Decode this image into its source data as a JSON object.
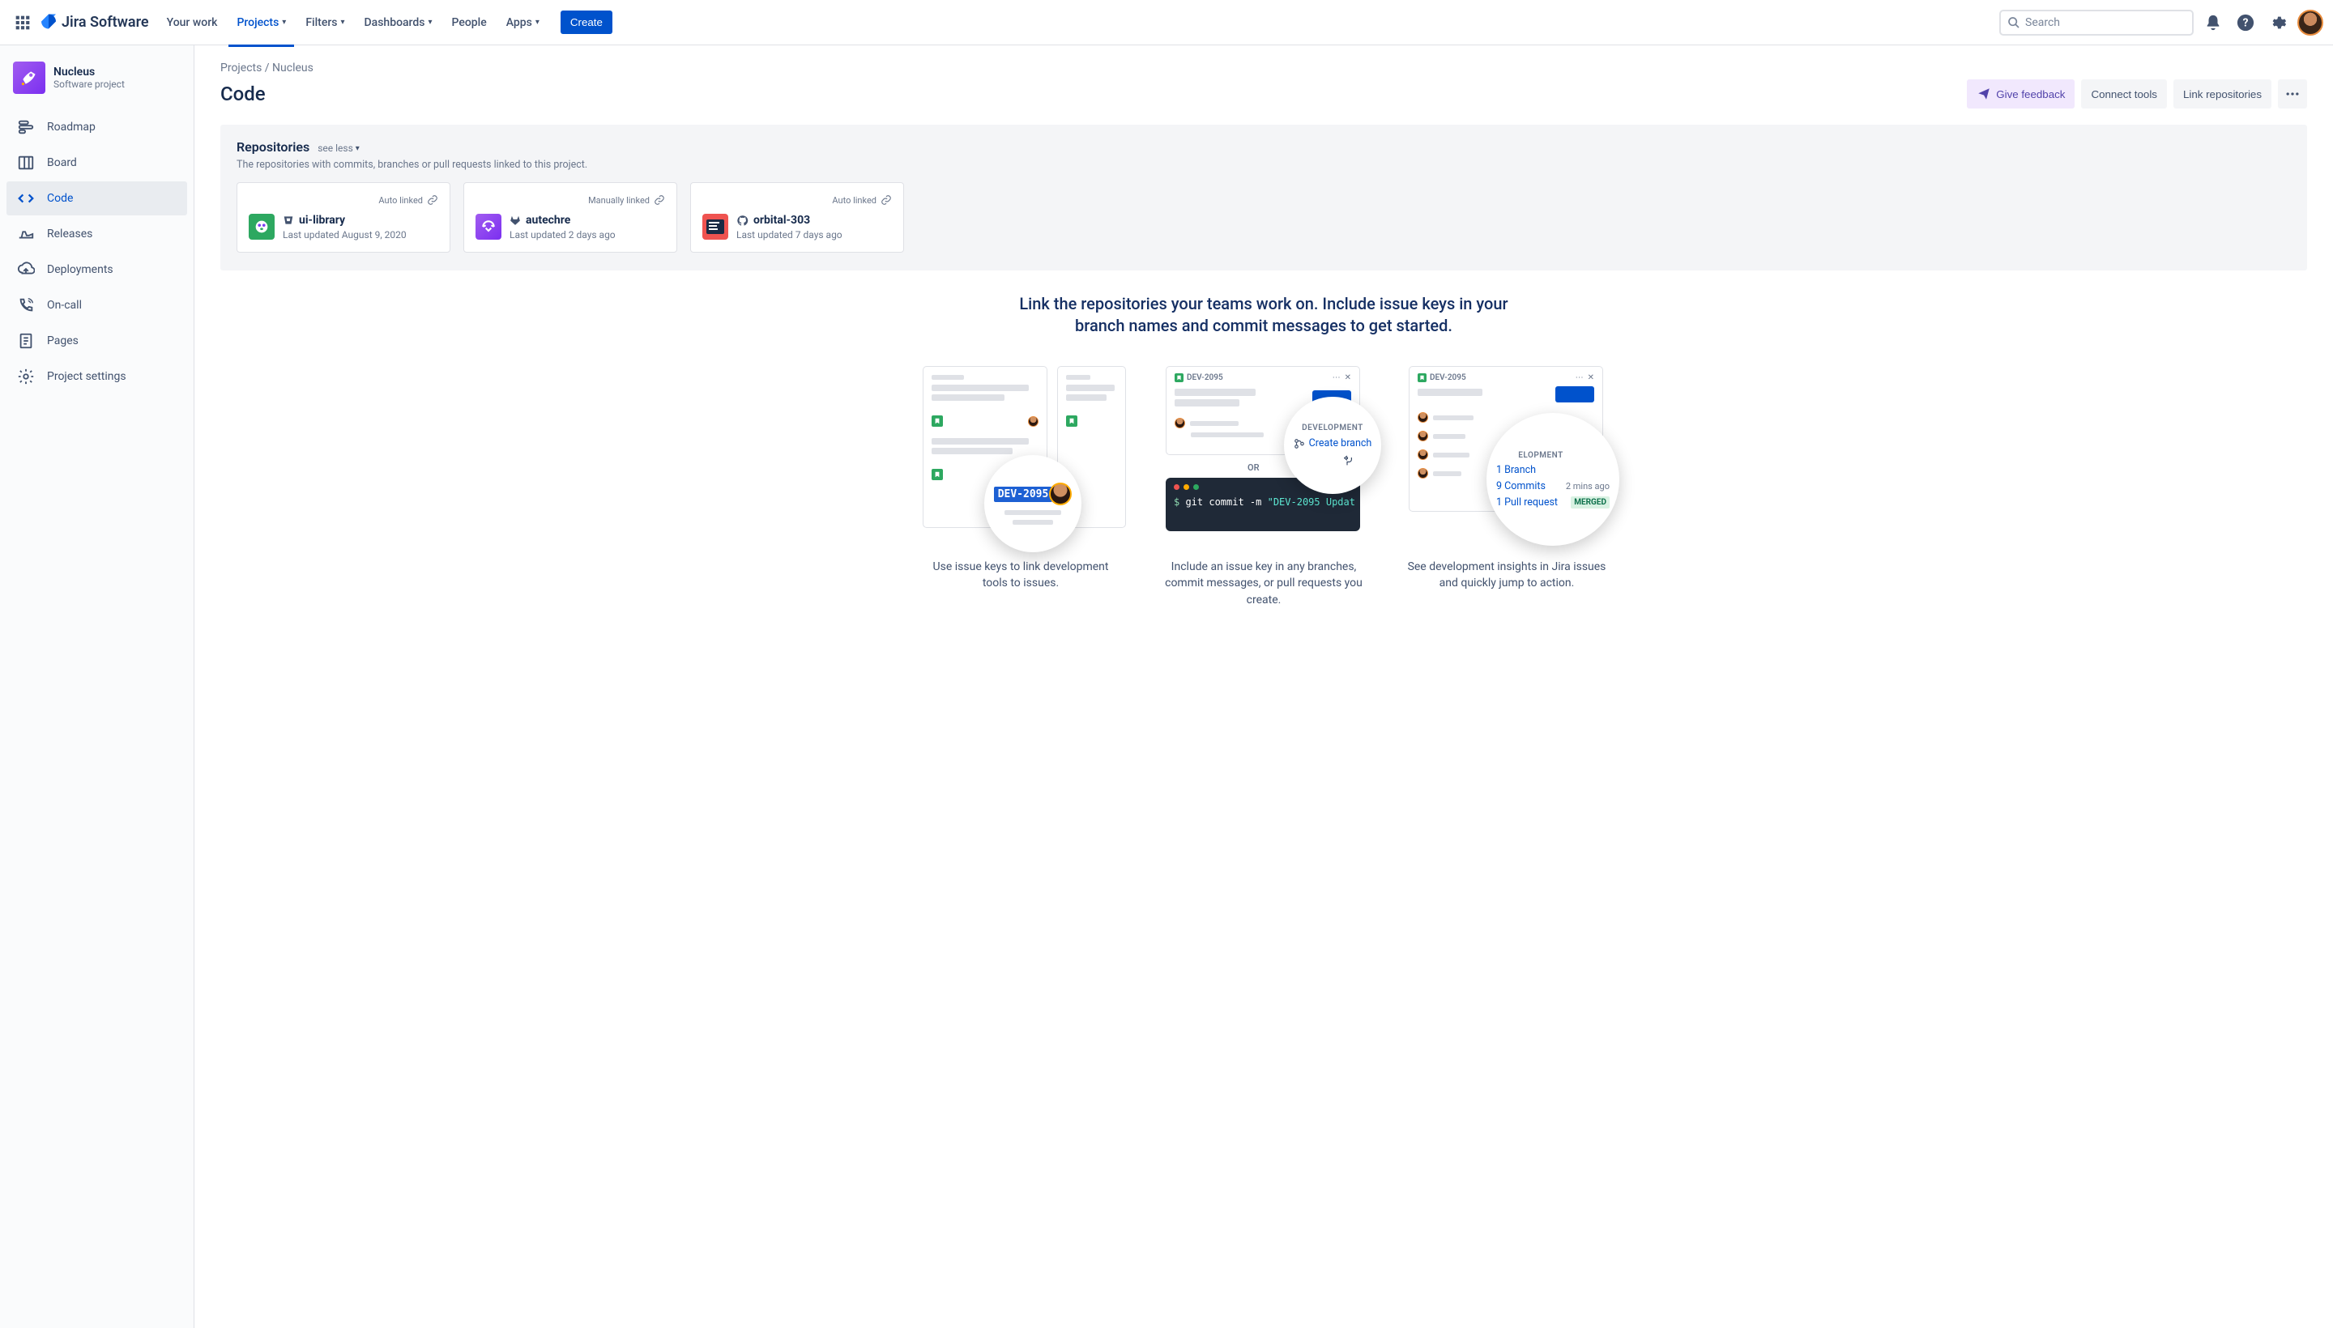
{
  "nav": {
    "logo": "Jira Software",
    "items": [
      "Your work",
      "Projects",
      "Filters",
      "Dashboards",
      "People",
      "Apps"
    ],
    "create": "Create",
    "search_placeholder": "Search"
  },
  "project": {
    "name": "Nucleus",
    "subtitle": "Software project"
  },
  "sidebar": {
    "items": [
      {
        "label": "Roadmap"
      },
      {
        "label": "Board"
      },
      {
        "label": "Code"
      },
      {
        "label": "Releases"
      },
      {
        "label": "Deployments"
      },
      {
        "label": "On-call"
      },
      {
        "label": "Pages"
      },
      {
        "label": "Project settings"
      }
    ]
  },
  "breadcrumb": "Projects / Nucleus",
  "page_title": "Code",
  "actions": {
    "feedback": "Give feedback",
    "connect": "Connect tools",
    "link": "Link repositories"
  },
  "repos": {
    "title": "Repositories",
    "toggle": "see less",
    "desc": "The repositories with commits, branches or pull requests linked to this project.",
    "cards": [
      {
        "link_type": "Auto linked",
        "name": "ui-library",
        "updated": "Last updated August 9, 2020",
        "icon_color": "#2da860"
      },
      {
        "link_type": "Manually linked",
        "name": "autechre",
        "updated": "Last updated 2 days ago",
        "icon_color": "#8b5cf6"
      },
      {
        "link_type": "Auto linked",
        "name": "orbital-303",
        "updated": "Last updated 7 days ago",
        "icon_color": "#ef5350"
      }
    ]
  },
  "hero": "Link the repositories your teams work on. Include issue keys in your branch names and commit messages to get started.",
  "illus": {
    "captions": [
      "Use issue keys to link development tools to issues.",
      "Include an issue key in any branches, commit messages, or pull requests you create.",
      "See development insights in Jira issues and quickly jump to action."
    ],
    "dev_key": "DEV-2095",
    "dev_key2": "DEV-2095",
    "dev_key3": "DEV-2095",
    "development": "DEVELOPMENT",
    "elopment": "ELOPMENT",
    "create_branch": "Create branch",
    "or": "OR",
    "git_cmd": "$ git commit -m \"DEV-2095 Updat",
    "branch": "1 Branch",
    "commits": "9 Commits",
    "pull": "1 Pull request",
    "mins": "2 mins ago",
    "merged": "MERGED"
  }
}
